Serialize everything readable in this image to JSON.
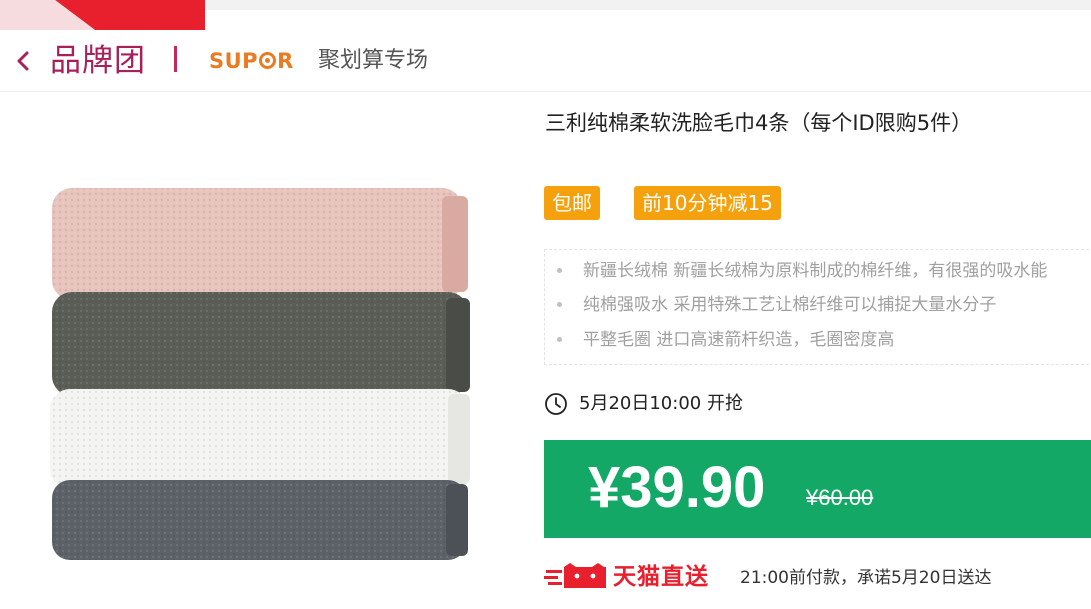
{
  "header": {
    "brand_title": "品牌团",
    "supor_prefix": "SUP",
    "supor_suffix": "R",
    "sub_title": "聚划算专场"
  },
  "product": {
    "title": "三利纯棉柔软洗脸毛巾4条（每个ID限购5件）",
    "tags": [
      "包邮",
      "前10分钟减15"
    ],
    "features": [
      "新疆长绒棉 新疆长绒棉为原料制成的棉纤维，有很强的吸水能",
      "纯棉强吸水 采用特殊工艺让棉纤维可以捕捉大量水分子",
      "平整毛圈 进口高速箭杆织造，毛圈密度高"
    ],
    "start_time": "5月20日10:00 开抢",
    "price_now": "¥39.90",
    "price_old": "¥60.00",
    "towel_colors": [
      "#e8c4bd",
      "#5b5e57",
      "#f4f4f2",
      "#5d6168"
    ]
  },
  "delivery": {
    "brand": "天猫直送",
    "note": "21:00前付款，承诺5月20日送达"
  },
  "colors": {
    "brand_red": "#a8205a",
    "supor_orange": "#ea7b22",
    "tag_orange": "#f5a00d",
    "price_green": "#13a866",
    "tmall_red": "#e8202e"
  },
  "icons": {
    "back": "chevron-left-icon",
    "clock": "clock-icon",
    "tmall": "tmall-cat-icon"
  }
}
